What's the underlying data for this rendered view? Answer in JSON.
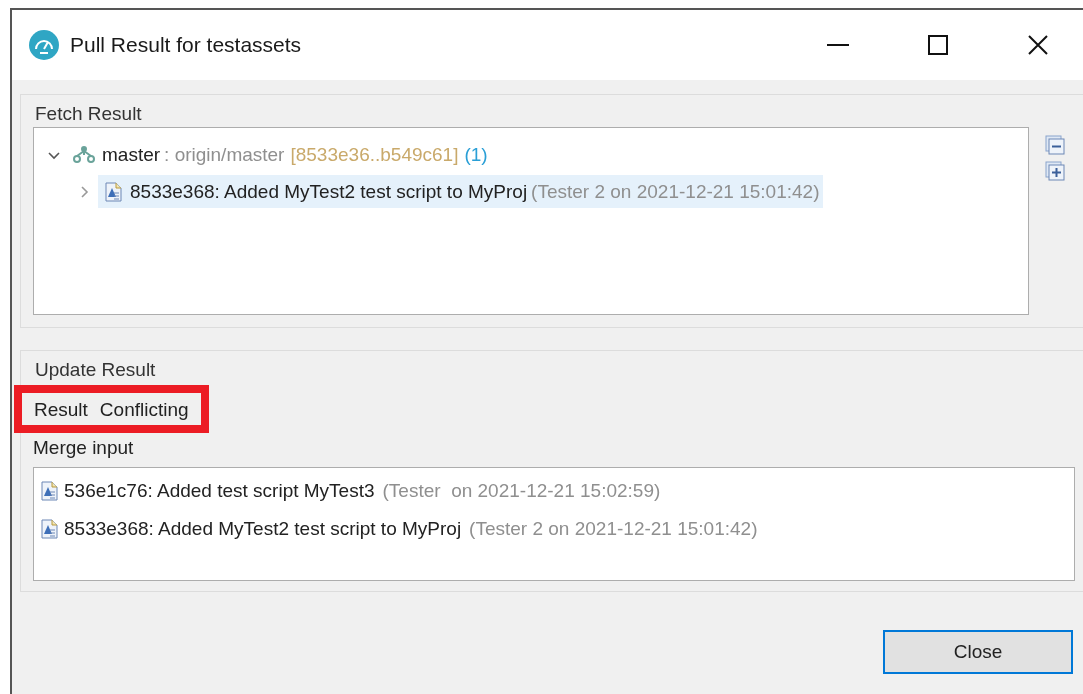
{
  "window": {
    "title": "Pull Result for testassets"
  },
  "fetch_result": {
    "label": "Fetch Result",
    "tree": [
      {
        "label": "master",
        "tracking": ": origin/master",
        "range": "[8533e36..b549c61]",
        "count": "(1)",
        "expanded": true,
        "selected": false,
        "kind": "branch",
        "children": [
          {
            "label": "8533e368: Added MyTest2 test script to MyProj",
            "detail": "(Tester 2 on 2021-12-21 15:01:42)",
            "expanded": false,
            "selected": true,
            "kind": "commit"
          }
        ]
      }
    ]
  },
  "update_result": {
    "label": "Update Result",
    "result_label": "Result",
    "result_value": "Conflicting",
    "highlighted": true,
    "merge_label": "Merge input",
    "merge_items": [
      {
        "label": "536e1c76: Added test script MyTest3",
        "detail": "(Tester  on 2021-12-21 15:02:59)"
      },
      {
        "label": "8533e368: Added MyTest2 test script to MyProj",
        "detail": "(Tester 2 on 2021-12-21 15:01:42)"
      }
    ]
  },
  "buttons": [
    "Close"
  ]
}
